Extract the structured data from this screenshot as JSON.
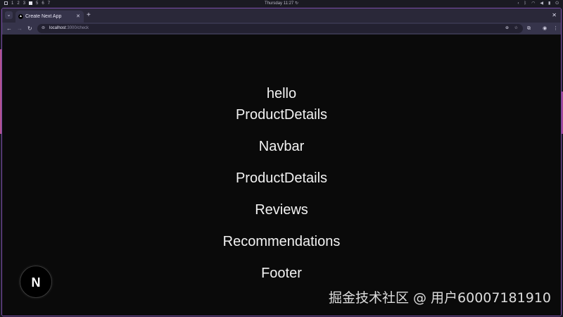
{
  "os_bar": {
    "workspaces": [
      "1",
      "2",
      "3",
      "4",
      "5",
      "6",
      "7"
    ],
    "clock": "Thursday 11:27"
  },
  "browser": {
    "tab_title": "Create Next App",
    "tab_favicon": "▲",
    "url_host": "localhost",
    "url_path": ":3000/check"
  },
  "page": {
    "lines": [
      "hello",
      "ProductDetails",
      "Navbar",
      "ProductDetails",
      "Reviews",
      "Recommendations",
      "Footer"
    ],
    "next_badge": "N",
    "watermark": "掘金技术社区 @ 用户60007181910"
  },
  "icons": {
    "tab_search": "chevron-down-icon",
    "new_tab": "plus-icon",
    "close": "close-icon",
    "back": "arrow-left-icon",
    "forward": "arrow-right-icon",
    "reload": "reload-icon",
    "site_info": "site-info-icon",
    "zoom": "zoom-icon",
    "bookmark": "star-icon",
    "extensions": "puzzle-icon",
    "profile": "profile-icon",
    "menu": "kebab-menu-icon"
  },
  "colors": {
    "page_background": "#0a0a0a",
    "page_text": "#ededed",
    "window_border": "#7b4ea8"
  }
}
